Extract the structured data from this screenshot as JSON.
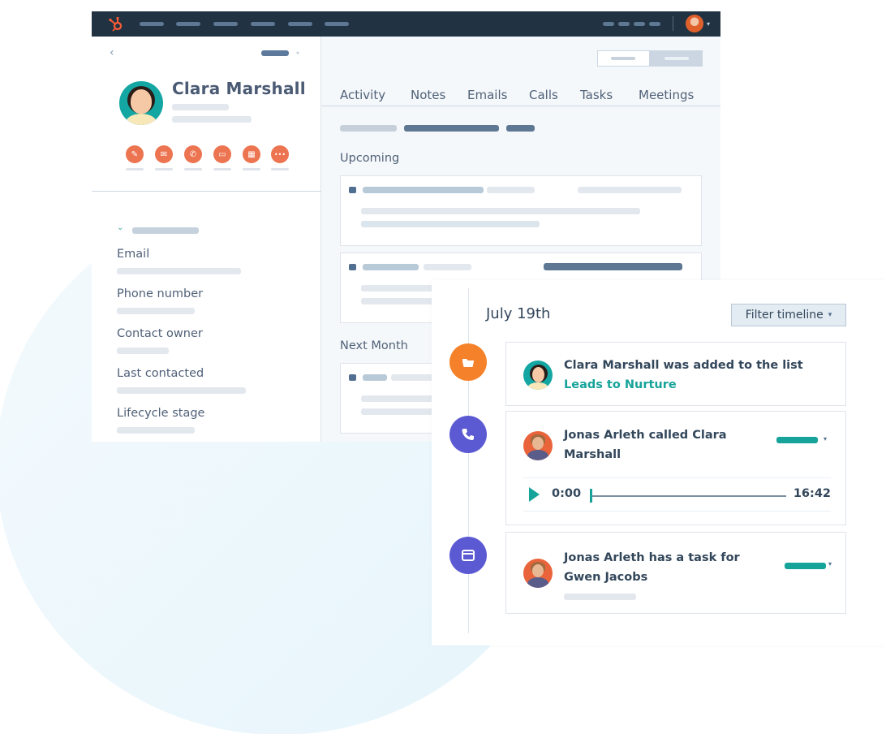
{
  "topbar": {
    "logo_icon": "hubspot-sprocket-icon",
    "nav_items_count": 6,
    "profile_caret": "▾"
  },
  "contact": {
    "back_icon": "‹",
    "name": "Clara Marshall",
    "actions": [
      {
        "name": "note",
        "icon": "✎"
      },
      {
        "name": "email",
        "icon": "✉"
      },
      {
        "name": "call",
        "icon": "✆"
      },
      {
        "name": "task",
        "icon": "▭"
      },
      {
        "name": "meeting",
        "icon": "▦"
      },
      {
        "name": "more",
        "icon": "•••"
      }
    ],
    "about_chevron": "⌄",
    "fields": [
      {
        "label": "Email"
      },
      {
        "label": "Phone number"
      },
      {
        "label": "Contact owner"
      },
      {
        "label": "Last contacted"
      },
      {
        "label": "Lifecycle stage"
      }
    ]
  },
  "tabs": [
    {
      "label": "Activity"
    },
    {
      "label": "Notes"
    },
    {
      "label": "Emails"
    },
    {
      "label": "Calls"
    },
    {
      "label": "Tasks"
    },
    {
      "label": "Meetings"
    }
  ],
  "sections": {
    "upcoming": "Upcoming",
    "next_month": "Next Month"
  },
  "timeline": {
    "date": "July 19th",
    "filter_label": "Filter timeline",
    "filter_caret": "▾",
    "items": [
      {
        "type": "list",
        "text": "Clara Marshall was added to the list ",
        "link": "Leads to Nurture",
        "icon_color": "#f5822a"
      },
      {
        "type": "call",
        "text": "Jonas Arleth called Clara Marshall",
        "icon_color": "#5c5ad3",
        "player": {
          "start": "0:00",
          "end": "16:42",
          "progress": 0
        }
      },
      {
        "type": "task",
        "text": "Jonas Arleth has a task for Gwen Jacobs",
        "icon_color": "#5c5ad3"
      }
    ]
  },
  "colors": {
    "topbar": "#213343",
    "accent_orange": "#ed7451",
    "teal": "#16a39a",
    "purple": "#5c5ad3"
  }
}
